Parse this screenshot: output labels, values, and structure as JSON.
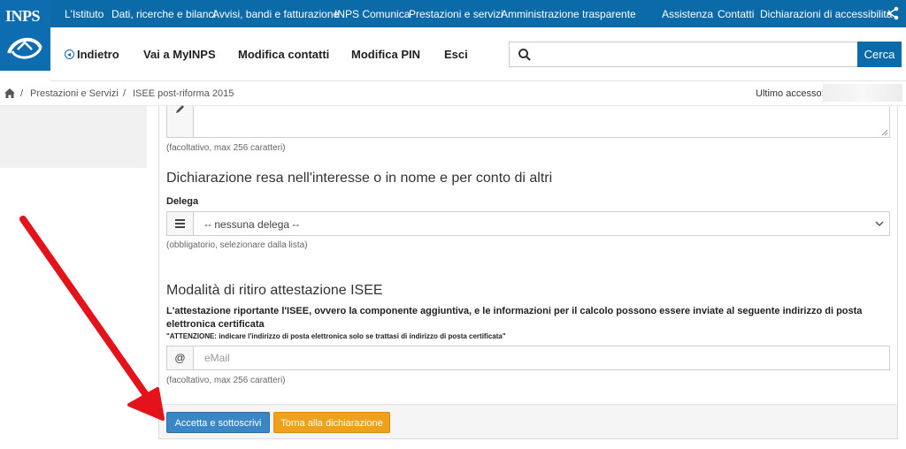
{
  "topbar": {
    "logo_text": "INPS",
    "links_left": [
      "L'Istituto",
      "Dati, ricerche e bilanci",
      "Avvisi, bandi e fatturazione",
      "INPS Comunica",
      "Prestazioni e servizi",
      "Amministrazione trasparente"
    ],
    "links_right": [
      "Assistenza",
      "Contatti",
      "Dichiarazioni di accessibilità"
    ]
  },
  "nav": {
    "back": "Indietro",
    "myinps": "Vai a MyINPS",
    "contacts": "Modifica contatti",
    "pin": "Modifica PIN",
    "exit": "Esci",
    "search_button": "Cerca"
  },
  "breadcrumb": {
    "items": [
      "Prestazioni e Servizi",
      "ISEE post-riforma 2015"
    ],
    "separator": "/",
    "last_access_label": "Ultimo accesso:"
  },
  "form": {
    "notes_help": "(facoltativo, max 256 caratteri)",
    "section_delega_title": "Dichiarazione resa nell'interesse o in nome e per conto di altri",
    "delega_label": "Delega",
    "delega_selected": "-- nessuna delega --",
    "delega_help": "(obbligatorio, selezionare dalla lista)",
    "section_ritiro_title": "Modalità di ritiro attestazione ISEE",
    "ritiro_text": "L'attestazione riportante l'ISEE, ovvero la componente aggiuntiva, e le informazioni per il calcolo possono essere inviate al seguente indirizzo di posta elettronica certificata",
    "ritiro_warning": "\"ATTENZIONE: indicare l'indirizzo di posta elettronica solo se trattasi di indirizzo di posta certificata\"",
    "email_addon": "@",
    "email_placeholder": "eMail",
    "email_help": "(facoltativo, max 256 caratteri)",
    "accept_button": "Accetta e sottoscrivi",
    "back_button": "Torna alla dichiarazione"
  },
  "colors": {
    "brand_blue": "#0b6aa8",
    "primary_button": "#3a87c8",
    "warning_button": "#f0a11c",
    "annotation_arrow": "#e3121b"
  }
}
